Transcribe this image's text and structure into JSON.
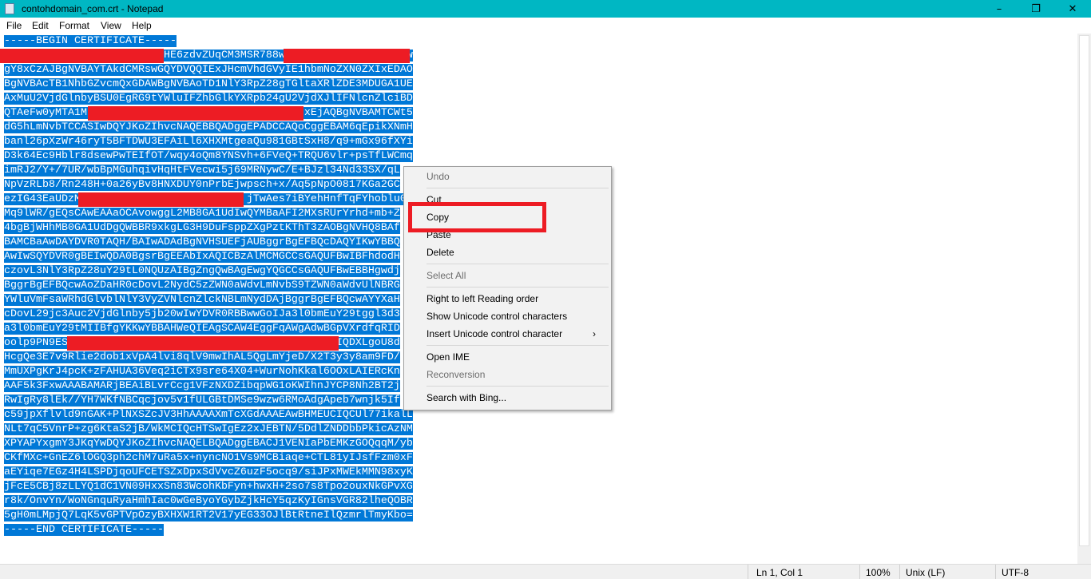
{
  "window": {
    "title": "contohdomain_com.crt - Notepad",
    "minimize": "–",
    "maximize": "❐",
    "close": "✕",
    "accent": "#00b7c3"
  },
  "menu": [
    "File",
    "Edit",
    "Format",
    "View",
    "Help"
  ],
  "editor": {
    "selection_color": "#0078d7",
    "lines": [
      "-----BEGIN CERTIFICATE-----",
      "                         HE6zdvZUqCM3MSR788w                   w",
      "gY8xCzAJBgNVBAYTAkdCMRswGQYDVQQIExJHcmVhdGVyIE1hbmNoZXN0ZXIxEDAO",
      "BgNVBAcTB1NhbGZvcmQxGDAWBgNVBAoTD1NlY3RpZ28gTGltaXRlZDE3MDUGA1UE",
      "AxMuU2VjdGlnbyBSU0EgRG9tYWluIFZhbGlkYXRpb24gU2VjdXJlIFNlcnZlciBD",
      "QTAeFw0yMTA1M                                  xEjAQBgNVBAMTCWt5",
      "dG5hLmNvbTCCASIwDQYJKoZIhvcNAQEBBQADggEPADCCAQoCggEBAM6qEpikXNmH",
      "banl26pXzWr46ryT5BFTDWU3EFAiLl6XHXMtgeaQu981GBtSxH8/q9+mGx96fXYi",
      "D3k64Ec9Hblr8dsewPwTEIfOT/wqy4oQm8YNSvh+6FVeQ+TRQU6vlr+psTfLWCmq",
      "imRJ2/Y+/7UR/wbBpMGuhqivHqHtFVecwi5j69MRNywC/E+BJzl34Nd33SX/qL",
      "NpVzRLb8/Rn248H+0a26yBv8HNXDUY0nPrbEjwpsch+x/Aq5pNpO0817KGa2GC",
      "ezIG43EaUDzM                          jTwAes7iBYehHnfTqFYhoblu0",
      "Mq9lWR/gEQsCAwEAAaOCAvowggL2MB8GA1UdIwQYMBaAFI2MXsRUrYrhd+mb+Z",
      "4bgBjWHhMB0GA1UdDgQWBBR9xkgLG3H9DuFsppZXgPztKThT3zAOBgNVHQ8BAf",
      "BAMCBaAwDAYDVR0TAQH/BAIwADAdBgNVHSUEFjAUBggrBgEFBQcDAQYIKwYBBQ",
      "AwIwSQYDVR0gBEIwQDA0BgsrBgEEAbIxAQICBzAlMCMGCCsGAQUFBwIBFhdodH",
      "czovL3NlY3RpZ28uY29tL0NQUzAIBgZngQwBAgEwgYQGCCsGAQUFBwEBBHgwdj",
      "BggrBgEFBQcwAoZDaHR0cDovL2NydC5zZWN0aWdvLmNvbS9TZWN0aWdvUlNBRG",
      "YWluVmFsaWRhdGlvblNlY3VyZVNlcnZlckNBLmNydDAjBggrBgEFBQcwAYYXaH",
      "cDovL29jc3Auc2VjdGlnby5jb20wIwYDVR0RBBwwGoIJa3l0bmEuY29tggl3d3",
      "a3l0bmEuY29tMIIBfgYKKwYBBAHWeQIEAgSCAW4EggFqAWgAdwBGpVXrdfqRID",
      "oolp9PN9ES                                          IQDXLgoU8d",
      "HcgQe3E7v9Rlie2dob1xVpA4lvi8qlV9mwIhAL5QgLmYjeD/X2T3y3y8am9FD/",
      "MmUXPgKrJ4pcK+zFAHUA36Veq2iCTx9sre64X04+WurNohKkal6OOxLAIERcKn",
      "AAF5k3FxwAAABAMARjBEAiBLvrCcg1VFzNXDZibqpWG1oKWIhnJYCP8Nh2BT2j",
      "RwIgRy8lEk//YH7WKfNBCqcjov5v1fULGBtDMSe9wzw6RMoAdgApeb7wnjk5If",
      "c59jpXflvld9nGAK+PlNXSZcJV3HhAAAAXmTcXGdAAAEAwBHMEUCIQCUl77ikalL",
      "NLt7qC5VnrP+zg6KtaS2jB/WkMCIQcHTSwIgEz2xJEBTN/5DdlZNDDbbPkicAzNM",
      "XPYAPYxgmY3JKqYwDQYJKoZIhvcNAQELBQADggEBACJ1VENIaPbEMKzGOQqqM/yb",
      "CKfMXc+GnEZ6lOGQ3ph2chM7uRa5x+nyncNO1Vs9MCBiaqe+CTL81yIJsfFzm0xF",
      "aEYiqe7EGz4H4LSPDjqoUFCETSZxDpxSdVvcZ6uzF5ocq9/siJPxMWEkMMN98xyK",
      "jFcE5CBj8zLLYQ1dC1VN09HxxSn83WcohKbFyn+hwxH+2so7s8Tpo2ouxNkGPvXG",
      "r8k/OnvYn/WoNGnquRyaHmhIac0wGeByoYGybZjkHcY5qzKyIGnsVGR82lheQOBR",
      "5gH0mLMpjQ7LqK5vGPTVpOzyBXHXW1RT2V17yEG33OJlBtRtneIlQzmrlTmyKbo=",
      "-----END CERTIFICATE-----"
    ]
  },
  "context_menu": {
    "items": [
      {
        "label": "Undo",
        "disabled": true
      },
      {
        "label": "Cut"
      },
      {
        "label": "Copy"
      },
      {
        "label": "Paste"
      },
      {
        "label": "Delete"
      },
      {
        "label": "Select All",
        "disabled": true
      },
      {
        "label": "Right to left Reading order"
      },
      {
        "label": "Show Unicode control characters"
      },
      {
        "label": "Insert Unicode control character",
        "submenu": "›"
      },
      {
        "label": "Open IME"
      },
      {
        "label": "Reconversion",
        "disabled": true
      },
      {
        "label": "Search with Bing..."
      }
    ],
    "highlight_color": "#ed1c24"
  },
  "status": {
    "position": "Ln 1, Col 1",
    "zoom": "100%",
    "line_ending": "Unix (LF)",
    "encoding": "UTF-8"
  }
}
